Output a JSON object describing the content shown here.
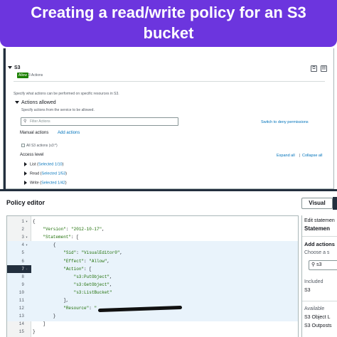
{
  "banner": {
    "line1": "Creating a read/write policy for an S3",
    "line2": "bucket"
  },
  "top_panel": {
    "service_name": "S3",
    "allow_badge": "Allow",
    "actions_count": "3 Actions",
    "description": "Specify what actions can be performed on specific resources in S3.",
    "actions_allowed_title": "Actions allowed",
    "actions_allowed_desc": "Specify actions from the service to be allowed.",
    "filter_placeholder": "Filter Actions",
    "switch_deny": "Switch to deny permissions",
    "manual_actions": "Manual actions",
    "add_actions": "Add actions",
    "all_actions": "All S3 actions (s3:*)",
    "access_level": "Access level",
    "expand_all": "Expand all",
    "collapse_all": "Collapse all",
    "levels": [
      {
        "name": "List",
        "selected": "Selected 1/10"
      },
      {
        "name": "Read",
        "selected": "Selected 1/53"
      },
      {
        "name": "Write",
        "selected": "Selected 1/42"
      }
    ]
  },
  "policy_editor": {
    "title": "Policy editor",
    "visual_tab": "Visual",
    "lines": [
      {
        "n": "1",
        "fold": "▾",
        "text": "{"
      },
      {
        "n": "2",
        "fold": "",
        "text": "    \"Version\": \"2012-10-17\","
      },
      {
        "n": "3",
        "fold": "▾",
        "text": "    \"Statement\": ["
      },
      {
        "n": "4",
        "fold": "▾",
        "text": "        {"
      },
      {
        "n": "5",
        "fold": "",
        "text": "            \"Sid\": \"VisualEditor0\","
      },
      {
        "n": "6",
        "fold": "",
        "text": "            \"Effect\": \"Allow\","
      },
      {
        "n": "7",
        "fold": "▾",
        "text": "            \"Action\": ["
      },
      {
        "n": "8",
        "fold": "",
        "text": "                \"s3:PutObject\","
      },
      {
        "n": "9",
        "fold": "",
        "text": "                \"s3:GetObject\","
      },
      {
        "n": "10",
        "fold": "",
        "text": "                \"s3:ListBucket\""
      },
      {
        "n": "11",
        "fold": "",
        "text": "            ],"
      },
      {
        "n": "12",
        "fold": "",
        "text": "            \"Resource\": \""
      },
      {
        "n": "13",
        "fold": "",
        "text": "        }"
      },
      {
        "n": "14",
        "fold": "",
        "text": "    ]"
      },
      {
        "n": "15",
        "fold": "",
        "text": "}"
      }
    ]
  },
  "right_panel": {
    "edit_statement": "Edit statemen",
    "statement": "Statemen",
    "add_actions": "Add actions",
    "choose": "Choose a s",
    "search_value": "s3",
    "included": "Included",
    "included_val": "S3",
    "available": "Available",
    "available_1": "S3 Object L",
    "available_2": "S3 Outposts"
  },
  "colors": {
    "banner": "#6c35de",
    "allow": "#1d8102",
    "link": "#0073bb"
  }
}
